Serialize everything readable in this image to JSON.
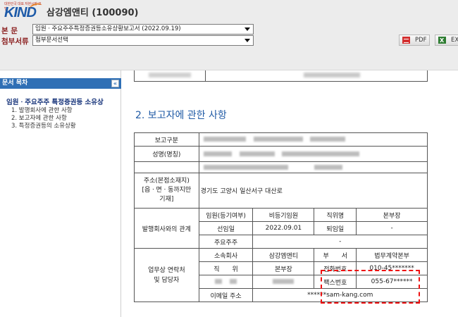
{
  "header": {
    "logo_tagline": "대한민국 대표 자본시장 포털",
    "logo_text": "KIND",
    "company": "삼강엠앤티 (100090)",
    "main_doc_label": "본 문",
    "main_doc_value": "임원ㆍ주요주주특정증권등소유상황보고서 (2022.09.19)",
    "attach_label": "첨부서류",
    "attach_value": "첨부문서선택",
    "pdf_label": "PDF",
    "excel_label": "EXC"
  },
  "sidebar": {
    "title": "문서 목차",
    "collapse_glyph": "«",
    "root": "임원ㆍ주요주주 특정증권등 소유상",
    "items": [
      "1. 발행회사에 관한 사항",
      "2. 보고자에 관한 사항",
      "3. 특정증권등의 소유상황"
    ]
  },
  "main": {
    "section_title": "2. 보고자에 관한 사항",
    "report_type_label": "보고구분",
    "name_label": "성명(명칭)",
    "address_label_l1": "주소(본점소재지)",
    "address_label_l2": "[읍ㆍ면ㆍ동까지만",
    "address_label_l3": "기재]",
    "address_value": "경기도 고양시 일산서구 대산로",
    "relation_label": "발행회사와의 관계",
    "officer_status_label": "임원(등기여부)",
    "officer_status_value": "비등기임원",
    "position_label": "직위명",
    "position_value": "본부장",
    "appointed_label": "선임일",
    "appointed_value": "2022.09.01",
    "resigned_label": "퇴임일",
    "resigned_value": "-",
    "major_holder_label": "주요주주",
    "major_holder_value": "-",
    "contact_label_l1": "업무상 연락처",
    "contact_label_l2": "및 담당자",
    "company_label": "소속회사",
    "company_value": "삼강엠앤티",
    "dept_label": "부　　서",
    "dept_value": "법무계약본부",
    "title_label": "직　　위",
    "title_value": "본부장",
    "phone_label": "전화번호",
    "phone_value": "010-45*******",
    "fax_label": "팩스번호",
    "fax_value": "055-67******",
    "email_label": "이메일 주소",
    "email_value": "******sam-kang.com"
  }
}
